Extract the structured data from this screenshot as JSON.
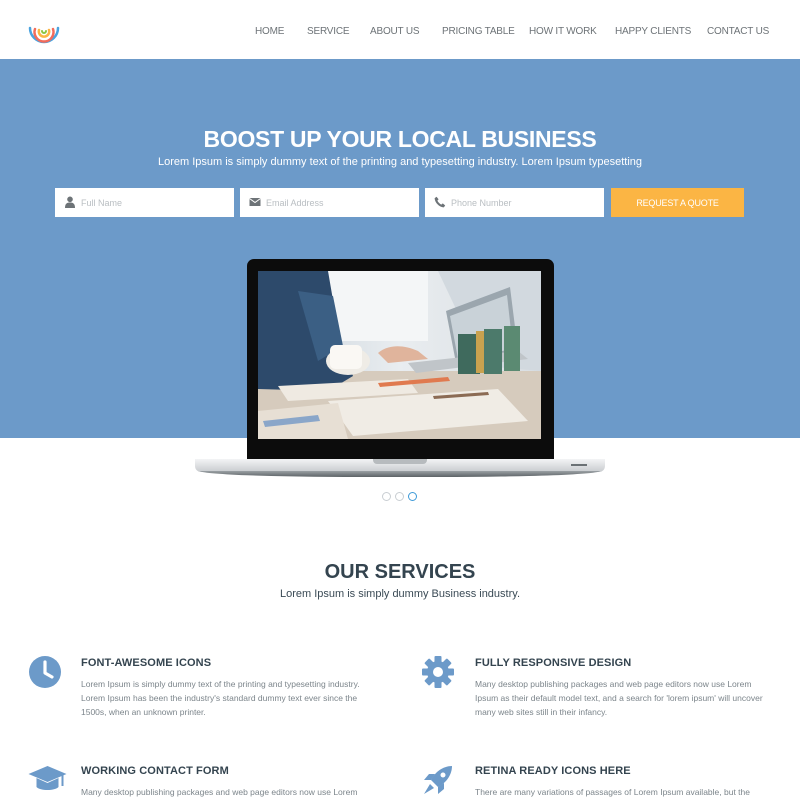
{
  "nav": {
    "items": [
      "HOME",
      "SERVICE",
      "ABOUT US",
      "PRICING TABLE",
      "HOW IT WORK",
      "HAPPY CLIENTS",
      "CONTACT US"
    ]
  },
  "hero": {
    "title": "BOOST UP YOUR LOCAL BUSINESS",
    "subtitle": "Lorem Ipsum is simply dummy text of the printing and typesetting industry. Lorem Ipsum typesetting",
    "form": {
      "name_placeholder": "Full Name",
      "email_placeholder": "Email Address",
      "phone_placeholder": "Phone Number",
      "submit_label": "REQUEST A QUOTE"
    },
    "slider": {
      "count": 3,
      "active_index": 2
    }
  },
  "services": {
    "title": "OUR SERVICES",
    "subtitle": "Lorem Ipsum is simply dummy Business industry.",
    "items": [
      {
        "icon": "clock-icon",
        "title": "FONT-AWESOME ICONS",
        "text": "Lorem Ipsum is simply dummy text of the printing and typesetting industry. Lorem Ipsum has been the industry's standard dummy text ever since the 1500s, when an unknown printer."
      },
      {
        "icon": "gear-icon",
        "title": "FULLY RESPONSIVE DESIGN",
        "text": "Many desktop publishing packages and web page editors now use Lorem Ipsum as their default model text, and a search for 'lorem ipsum' will uncover many web sites still in their infancy."
      },
      {
        "icon": "graduation-cap-icon",
        "title": "WORKING CONTACT FORM",
        "text": "Many desktop publishing packages and web page editors now use Lorem Ipsum"
      },
      {
        "icon": "rocket-icon",
        "title": "RETINA READY ICONS HERE",
        "text": "There are many variations of passages of Lorem Ipsum available, but the"
      }
    ]
  },
  "colors": {
    "hero_bg": "#6c9ac9",
    "accent": "#fbb544",
    "icon": "#6c9ac9",
    "heading": "#34444f"
  }
}
